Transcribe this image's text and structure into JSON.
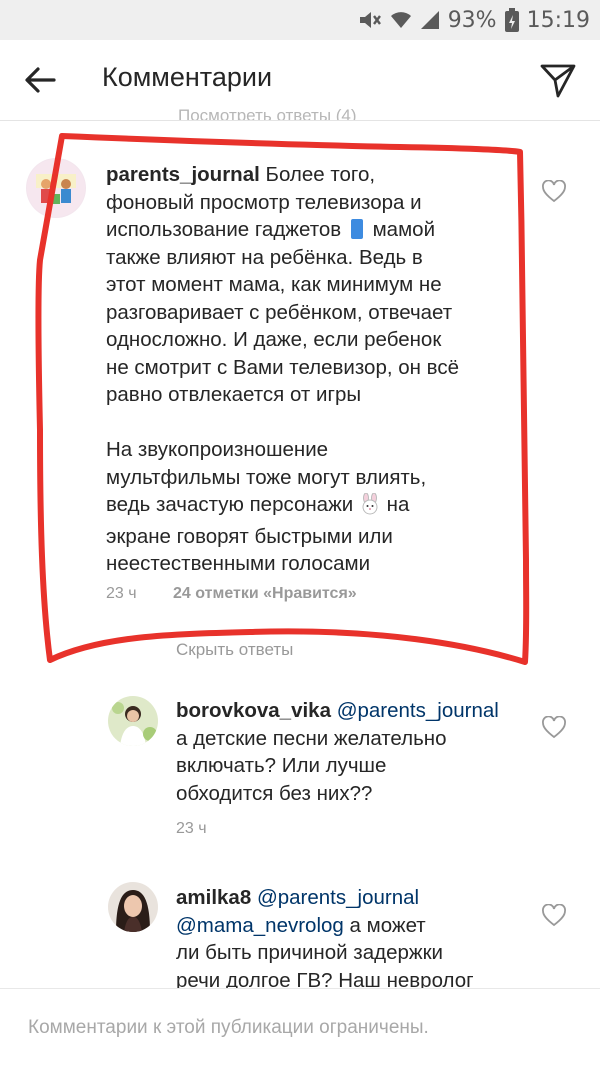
{
  "status_bar": {
    "battery": "93%",
    "time": "15:19",
    "icons": [
      "mute-icon",
      "wifi-icon",
      "signal-icon",
      "battery-icon"
    ]
  },
  "header": {
    "title": "Комментарии",
    "back_icon": "arrow-left-icon",
    "send_icon": "paper-plane-icon"
  },
  "partial_text": "Посмотреть ответы (4)",
  "main_comment": {
    "username": "parents_journal",
    "lines": [
      "Более того,",
      "фоновый просмотр телевизора и",
      "использование гаджетов",
      "мамой",
      "также влияют на ребёнка. Ведь в",
      "этот момент мама, как минимум не",
      "разговаривает с ребёнком, отвечает",
      "односложно. И даже, если ребенок",
      "не смотрит с Вами телевизор, он всё",
      "равно отвлекается от игры",
      "На звукопроизношение",
      "мультфильмы тоже могут влиять,",
      "ведь зачастую персонажи",
      "на",
      "экране говорят быстрыми или",
      "неестественными голосами"
    ],
    "time": "23 ч",
    "likes": "24 отметки «Нравится»"
  },
  "hide_replies": "Скрыть ответы",
  "replies": [
    {
      "username": "borovkova_vika",
      "mention": "@parents_journal",
      "lines": [
        "а детские песни желательно",
        "включать? Или лучше",
        "обходится без них??"
      ],
      "time": "23 ч"
    },
    {
      "username": "amilka8",
      "mention": "@parents_journal",
      "mention2": "@mama_nevrolog",
      "lines": [
        "а может",
        "ли быть причиной задержки",
        "речи долгое ГВ? Наш невролог"
      ]
    }
  ],
  "footer": {
    "text": "Комментарии к этой публикации ограничены."
  },
  "colors": {
    "annotation": "#e8322b",
    "mention": "#003569",
    "meta": "#999999"
  }
}
